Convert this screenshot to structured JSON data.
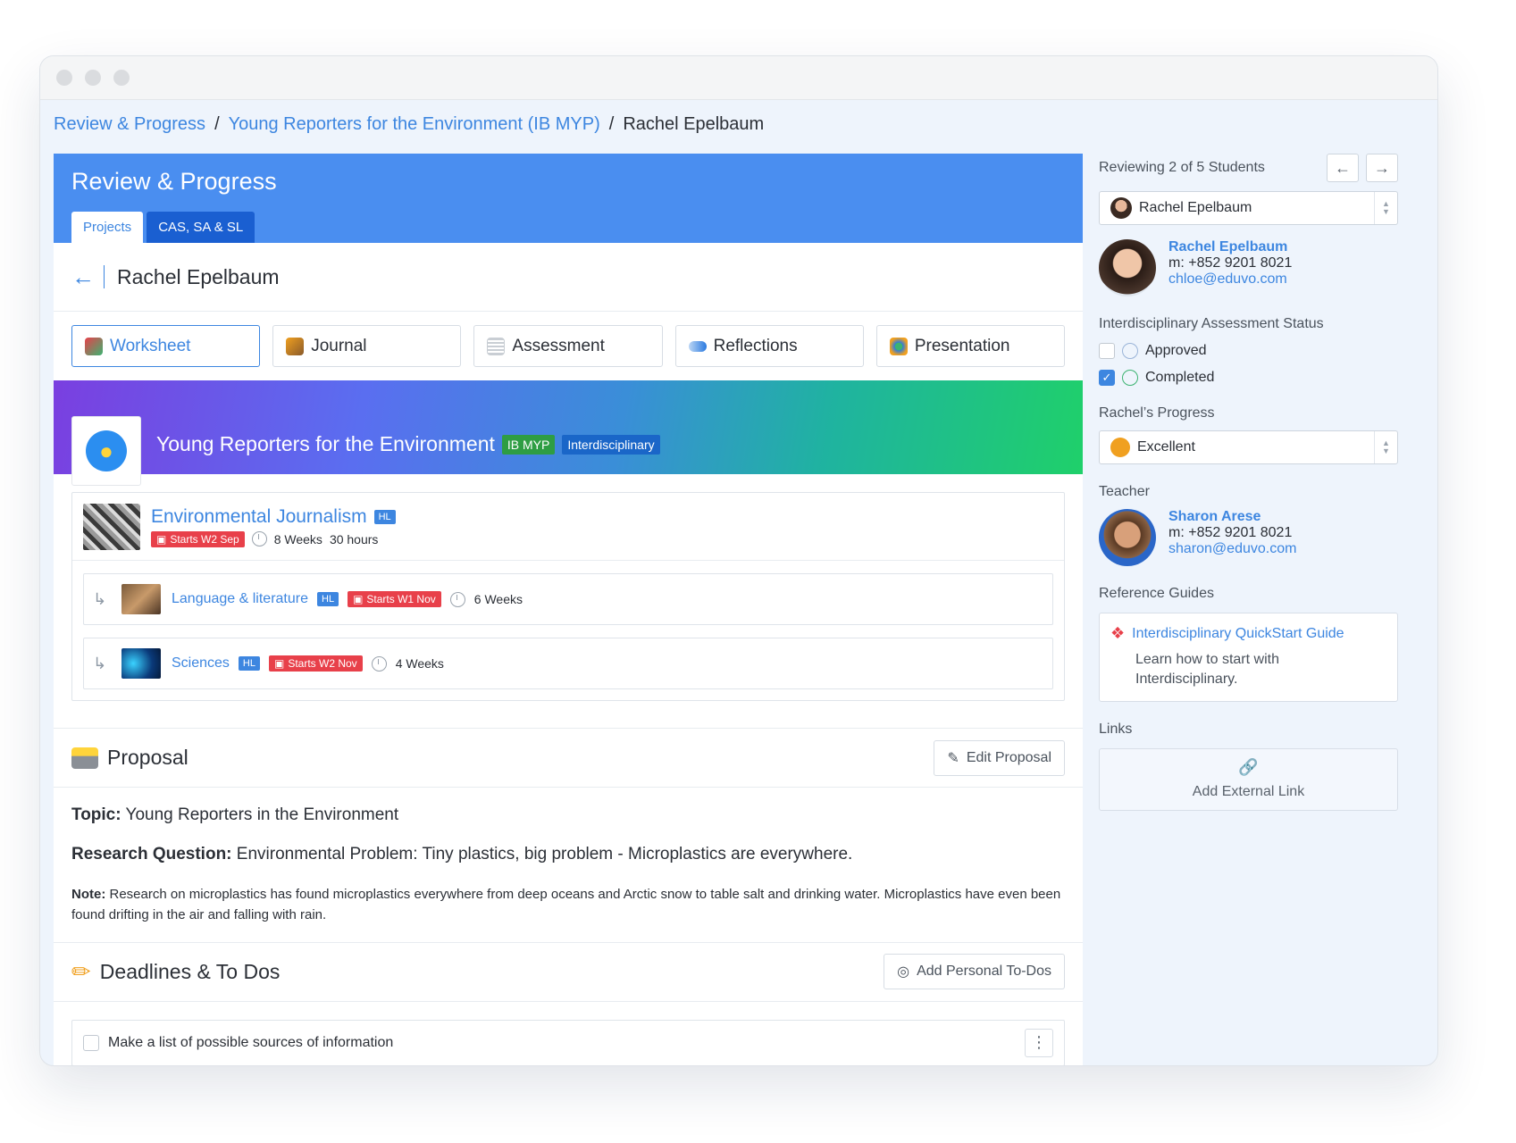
{
  "breadcrumb": {
    "item1": "Review & Progress",
    "sep": "/",
    "item2": "Young Reporters for the Environment (IB MYP)",
    "current": "Rachel Epelbaum"
  },
  "header": {
    "title": "Review & Progress",
    "tab_projects": "Projects",
    "tab_cas": "CAS, SA & SL"
  },
  "student": {
    "name": "Rachel Epelbaum"
  },
  "subtabs": {
    "worksheet": "Worksheet",
    "journal": "Journal",
    "assessment": "Assessment",
    "reflections": "Reflections",
    "presentation": "Presentation"
  },
  "project": {
    "title": "Young Reporters for the Environment",
    "badge1": "IB MYP",
    "badge2": "Interdisciplinary"
  },
  "course": {
    "title": "Environmental Journalism",
    "level": "HL",
    "starts": "Starts W2 Sep",
    "weeks": "8 Weeks",
    "hours": "30 hours"
  },
  "subcourses": [
    {
      "title": "Language & literature",
      "level": "HL",
      "starts": "Starts W1 Nov",
      "weeks": "6 Weeks"
    },
    {
      "title": "Sciences",
      "level": "HL",
      "starts": "Starts W2 Nov",
      "weeks": "4 Weeks"
    }
  ],
  "proposal": {
    "title": "Proposal",
    "edit_label": "Edit Proposal",
    "topic_label": "Topic:",
    "topic": "Young Reporters in the Environment",
    "rq_label": "Research Question:",
    "rq": "Environmental Problem: Tiny plastics, big problem - Microplastics are everywhere.",
    "note_label": "Note:",
    "note": "Research on microplastics has found microplastics everywhere from deep oceans and Arctic snow to table salt and drinking water. Microplastics have even been found drifting in the air and falling with rain."
  },
  "deadlines": {
    "title": "Deadlines & To Dos",
    "add_label": "Add Personal To-Dos",
    "todos": [
      "Make a list of possible sources of information"
    ]
  },
  "sidebar": {
    "reviewing": "Reviewing 2 of 5 Students",
    "selected_student": "Rachel Epelbaum",
    "student_profile": {
      "name": "Rachel Epelbaum",
      "phone": "m: +852 9201 8021",
      "email": "chloe@eduvo.com"
    },
    "status_title": "Interdisciplinary Assessment Status",
    "status_approved": "Approved",
    "status_completed": "Completed",
    "progress_title": "Rachel’s Progress",
    "progress_value": "Excellent",
    "teacher_title": "Teacher",
    "teacher_profile": {
      "name": "Sharon Arese",
      "phone": "m: +852 9201 8021",
      "email": "sharon@eduvo.com"
    },
    "guides_title": "Reference Guides",
    "guide_title": "Interdisciplinary QuickStart Guide",
    "guide_desc": "Learn how to start with Interdisciplinary.",
    "links_title": "Links",
    "add_link": "Add External Link"
  },
  "colors": {
    "accent": "#3d86e0",
    "header": "#4a8ef0",
    "tab_dark": "#1a5fd1",
    "danger": "#e8404a",
    "green": "#2e9d43"
  }
}
